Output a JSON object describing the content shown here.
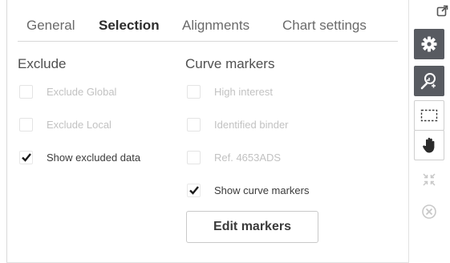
{
  "tabs": [
    {
      "label": "General",
      "active": false
    },
    {
      "label": "Selection",
      "active": true
    },
    {
      "label": "Alignments",
      "active": false
    },
    {
      "label": "Chart settings",
      "active": false
    }
  ],
  "exclude": {
    "title": "Exclude",
    "items": [
      {
        "label": "Exclude Global",
        "checked": false,
        "enabled": false
      },
      {
        "label": "Exclude Local",
        "checked": false,
        "enabled": false
      },
      {
        "label": "Show excluded data",
        "checked": true,
        "enabled": true
      }
    ]
  },
  "curve_markers": {
    "title": "Curve markers",
    "items": [
      {
        "label": "High interest",
        "checked": false,
        "enabled": false
      },
      {
        "label": "Identified binder",
        "checked": false,
        "enabled": false
      },
      {
        "label": "Ref. 4653ADS",
        "checked": false,
        "enabled": false
      },
      {
        "label": "Show curve markers",
        "checked": true,
        "enabled": true
      }
    ],
    "edit_button": "Edit markers"
  },
  "toolbar": {
    "icons": [
      "expand-corner-icon",
      "gear-icon",
      "zoom-select-icon",
      "rectangle-select-icon",
      "hand-pan-icon",
      "fit-arrows-icon",
      "close-circle-icon"
    ],
    "colors": {
      "active_bg": "#585b61",
      "icon_light": "#ffffff",
      "icon_disabled": "#c8c8c8",
      "icon_dark": "#3a3a3a"
    }
  }
}
